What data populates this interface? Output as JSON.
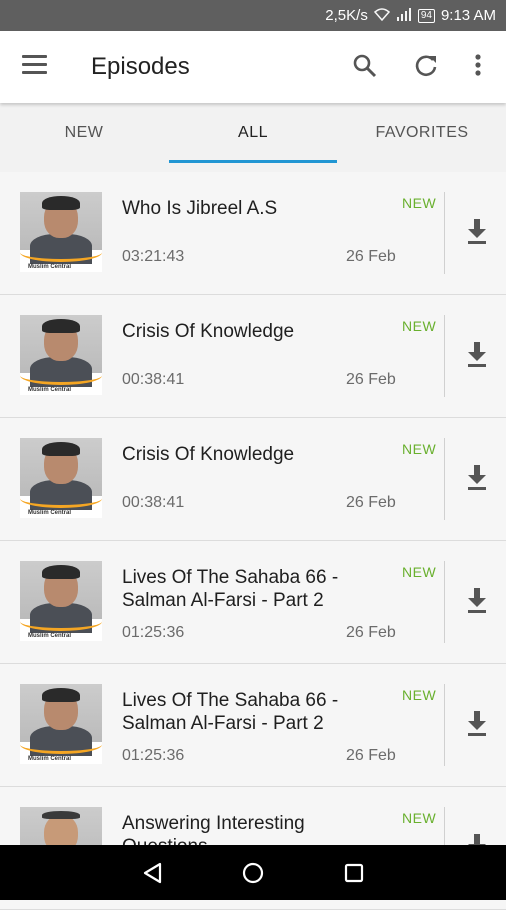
{
  "status_bar": {
    "net_speed": "2,5K/s",
    "battery": "94",
    "time": "9:13 AM"
  },
  "app_bar": {
    "title": "Episodes"
  },
  "tabs": [
    {
      "label": "NEW"
    },
    {
      "label": "ALL"
    },
    {
      "label": "FAVORITES"
    }
  ],
  "episodes": [
    {
      "title": "Who Is Jibreel A.S",
      "duration": "03:21:43",
      "date": "26 Feb",
      "badge": "NEW"
    },
    {
      "title": "Crisis Of Knowledge",
      "duration": "00:38:41",
      "date": "26 Feb",
      "badge": "NEW"
    },
    {
      "title": "Crisis Of Knowledge",
      "duration": "00:38:41",
      "date": "26 Feb",
      "badge": "NEW"
    },
    {
      "title": "Lives Of The Sahaba 66 - Salman Al-Farsi - Part 2",
      "duration": "01:25:36",
      "date": "26 Feb",
      "badge": "NEW"
    },
    {
      "title": "Lives Of The Sahaba 66 - Salman Al-Farsi - Part 2",
      "duration": "01:25:36",
      "date": "26 Feb",
      "badge": "NEW"
    },
    {
      "title": "Answering Interesting Questions",
      "duration": "",
      "date": "",
      "badge": "NEW"
    }
  ],
  "thumbnail_brand": "Muslim Central",
  "colors": {
    "accent": "#2196d3",
    "badge_new": "#69b02e",
    "status_bar": "#5f5f5f"
  },
  "icons": [
    "menu-icon",
    "search-icon",
    "refresh-icon",
    "more-vert-icon",
    "download-icon",
    "back-icon",
    "home-icon",
    "recents-icon"
  ]
}
